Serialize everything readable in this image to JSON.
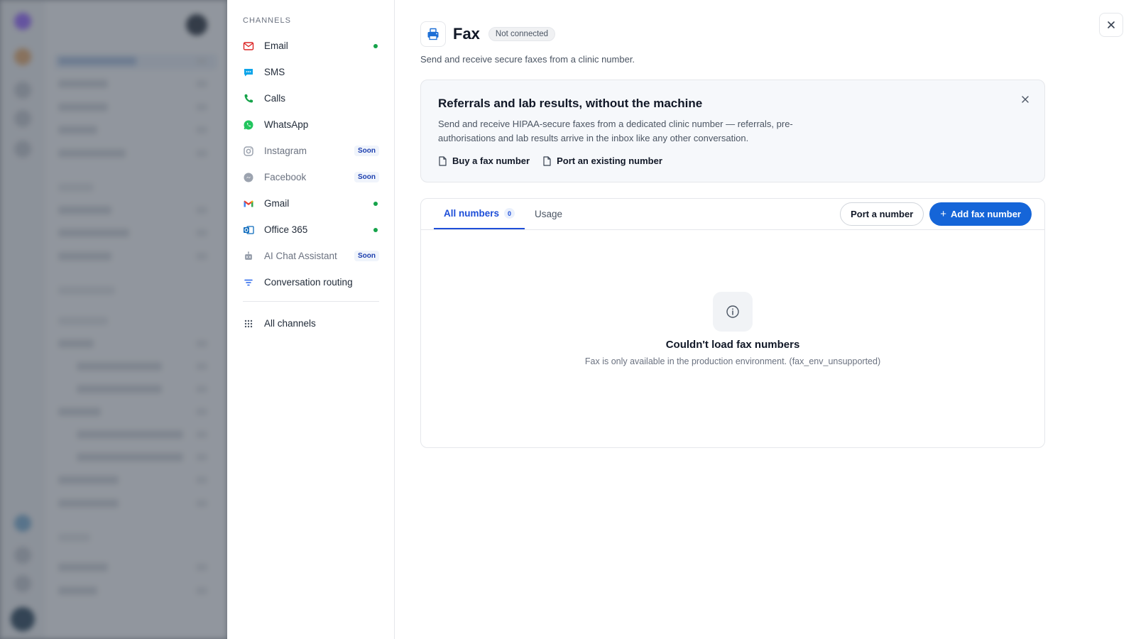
{
  "channels": {
    "section_title": "CHANNELS",
    "items": [
      {
        "label": "Email",
        "icon": "mail-icon",
        "connected": true
      },
      {
        "label": "SMS",
        "icon": "message-icon",
        "connected": false
      },
      {
        "label": "Calls",
        "icon": "phone-icon",
        "connected": false
      },
      {
        "label": "WhatsApp",
        "icon": "whatsapp-icon",
        "connected": false
      },
      {
        "label": "Instagram",
        "icon": "instagram-icon",
        "badge": "Soon"
      },
      {
        "label": "Facebook",
        "icon": "messenger-icon",
        "badge": "Soon"
      },
      {
        "label": "Gmail",
        "icon": "gmail-icon",
        "connected": true
      },
      {
        "label": "Office 365",
        "icon": "outlook-icon",
        "connected": true
      },
      {
        "label": "AI Chat Assistant",
        "icon": "robot-icon",
        "badge": "Soon"
      },
      {
        "label": "Conversation routing",
        "icon": "filter-icon",
        "connected": false
      }
    ],
    "all_channels": "All channels"
  },
  "header": {
    "title": "Fax",
    "status": "Not connected",
    "subtitle": "Send and receive secure faxes from a clinic number."
  },
  "promo": {
    "title": "Referrals and lab results, without the machine",
    "text": "Send and receive HIPAA-secure faxes from a dedicated clinic number — referrals, pre-authorisations and lab results arrive in the inbox like any other conversation.",
    "link_buy": "Buy a fax number",
    "link_port": "Port an existing number"
  },
  "tabs": {
    "all_numbers": "All numbers",
    "all_numbers_count": "0",
    "usage": "Usage"
  },
  "actions": {
    "port": "Port a number",
    "add": "Add fax number"
  },
  "empty": {
    "title": "Couldn't load fax numbers",
    "text": "Fax is only available in the production environment. (fax_env_unsupported)"
  },
  "colors": {
    "accent": "#1565d8",
    "connected": "#16a34a",
    "email": "#dc2626",
    "sms": "#0ea5e9",
    "calls": "#16a34a",
    "whatsapp": "#22c55e"
  }
}
